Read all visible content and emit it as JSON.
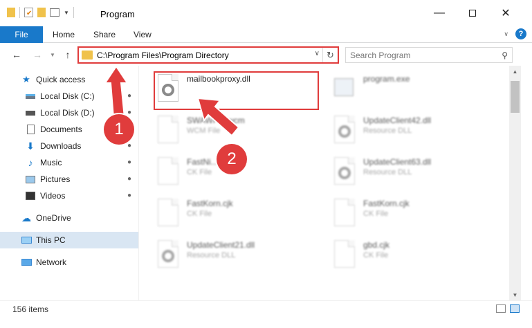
{
  "window": {
    "title": "Program"
  },
  "ribbon": {
    "tabs": [
      "File",
      "Home",
      "Share",
      "View"
    ]
  },
  "address": {
    "path": "C:\\Program Files\\Program Directory"
  },
  "search": {
    "placeholder": "Search Program"
  },
  "sidebar": {
    "items": [
      {
        "label": "Quick access",
        "icon": "star-icon"
      },
      {
        "label": "Local Disk (C:)",
        "icon": "drive-icon",
        "pinned": true
      },
      {
        "label": "Local Disk (D:)",
        "icon": "drive-icon",
        "pinned": true
      },
      {
        "label": "Documents",
        "icon": "documents-icon",
        "pinned": true
      },
      {
        "label": "Downloads",
        "icon": "downloads-icon",
        "pinned": true
      },
      {
        "label": "Music",
        "icon": "music-icon",
        "pinned": true
      },
      {
        "label": "Pictures",
        "icon": "pictures-icon",
        "pinned": true
      },
      {
        "label": "Videos",
        "icon": "videos-icon",
        "pinned": true
      },
      {
        "label": "OneDrive",
        "icon": "cloud-icon"
      },
      {
        "label": "This PC",
        "icon": "computer-icon",
        "selected": true
      },
      {
        "label": "Network",
        "icon": "network-icon"
      }
    ]
  },
  "files": [
    {
      "name": "mailbookproxy.dll",
      "type": "",
      "highlighted": true
    },
    {
      "name": "program.exe",
      "type": ""
    },
    {
      "name": "SWAWPI2.wcm",
      "type": "WCM File"
    },
    {
      "name": "UpdateClient42.dll",
      "type": "Resource DLL"
    },
    {
      "name": "FastNi...",
      "type": "CK File"
    },
    {
      "name": "UpdateClient63.dll",
      "type": "Resource DLL"
    },
    {
      "name": "FastKorn.cjk",
      "type": "CK File"
    },
    {
      "name": "FastKorn.cjk",
      "type": "CK File"
    },
    {
      "name": "UpdateClient21.dll",
      "type": "Resource DLL"
    },
    {
      "name": "gbd.cjk",
      "type": "CK File"
    }
  ],
  "status": {
    "count": "156 items"
  },
  "annotations": [
    "1",
    "2"
  ],
  "colors": {
    "accent": "#1979ca",
    "highlight": "#e03c3c",
    "folder": "#f0c24b"
  }
}
